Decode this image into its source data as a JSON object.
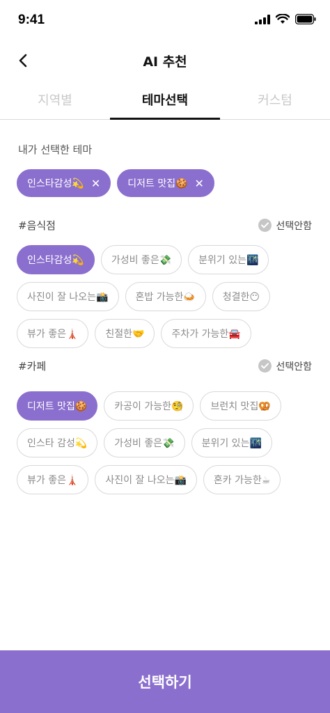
{
  "status": {
    "time": "9:41"
  },
  "header": {
    "title": "AI 추천"
  },
  "tabs": [
    {
      "label": "지역별",
      "active": false
    },
    {
      "label": "테마선택",
      "active": true
    },
    {
      "label": "커스텀",
      "active": false
    }
  ],
  "selected_section": {
    "label": "내가 선택한 테마",
    "chips": [
      {
        "label": "인스타감성💫",
        "remove": "✕"
      },
      {
        "label": "디저트 맛집🍪",
        "remove": "✕"
      }
    ]
  },
  "restaurant": {
    "title": "#음식점",
    "no_select": "선택안함",
    "rows": [
      [
        {
          "label": "인스타감성💫",
          "selected": true
        },
        {
          "label": "가성비 좋은💸",
          "selected": false
        },
        {
          "label": "분위기 있는🌃",
          "selected": false
        }
      ],
      [
        {
          "label": "사진이 잘 나오는📸",
          "selected": false
        },
        {
          "label": "혼밥 가능한🍛",
          "selected": false
        },
        {
          "label": "청결한😶",
          "selected": false
        }
      ],
      [
        {
          "label": "뷰가 좋은🗼",
          "selected": false
        },
        {
          "label": "친절한🤝",
          "selected": false
        },
        {
          "label": "주차가 가능한🚘",
          "selected": false
        }
      ]
    ]
  },
  "cafe": {
    "title": "#카페",
    "no_select": "선택안함",
    "rows": [
      [
        {
          "label": "디저트 맛집🍪",
          "selected": true
        },
        {
          "label": "카공이 가능한🧐",
          "selected": false
        },
        {
          "label": "브런치 맛집🥨",
          "selected": false
        }
      ],
      [
        {
          "label": "인스타 감성💫",
          "selected": false
        },
        {
          "label": "가성비 좋은💸",
          "selected": false
        },
        {
          "label": "분위기 있는🌃",
          "selected": false
        }
      ],
      [
        {
          "label": "뷰가 좋은🗼",
          "selected": false
        },
        {
          "label": "사진이 잘 나오는📸",
          "selected": false
        },
        {
          "label": "혼카 가능한☕",
          "selected": false
        }
      ]
    ]
  },
  "submit": {
    "label": "선택하기"
  }
}
